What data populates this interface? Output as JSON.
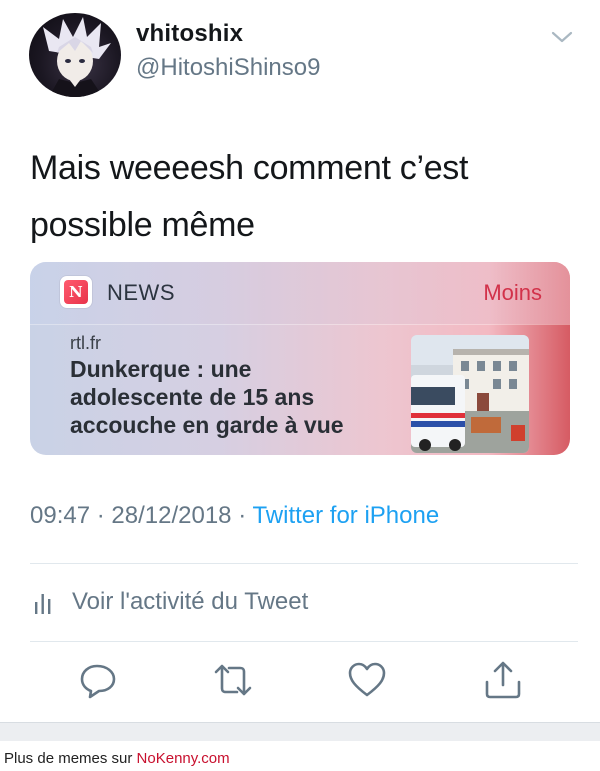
{
  "tweet": {
    "author": {
      "display_name": "vhitoshix",
      "handle": "@HitoshiShinso9"
    },
    "text_line1": "Mais weeeesh comment c’est",
    "text_line2": "possible même",
    "card": {
      "app_icon": "apple-news-icon",
      "app_name": "NEWS",
      "collapse_label": "Moins",
      "source": "rtl.fr",
      "headline_line1": "Dunkerque : une",
      "headline_line2": "adolescente de 15 ans",
      "headline_line3": "accouche en garde à vue",
      "accent_color": "#d2324a"
    },
    "meta": {
      "time": "09:47",
      "date": "28/12/2018",
      "separator": "·",
      "via": "Twitter for iPhone"
    },
    "activity_label": "Voir l'activité du Tweet",
    "actions": [
      "reply-icon",
      "retweet-icon",
      "like-icon",
      "share-icon"
    ],
    "link_color": "#1da1f2"
  },
  "footer": {
    "prefix": "Plus de memes sur ",
    "site": "NoKenny.com"
  }
}
